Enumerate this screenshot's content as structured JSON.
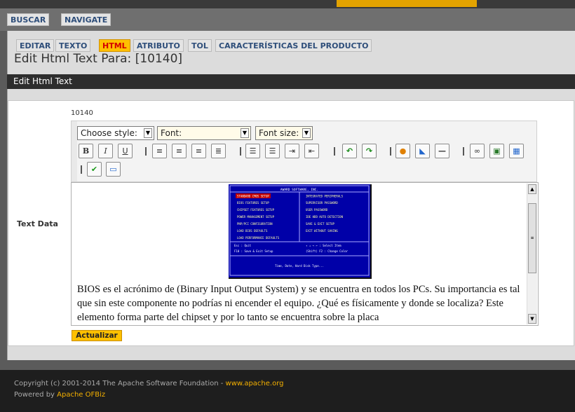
{
  "nav": {
    "buscar": "BUSCAR",
    "navigate": "NAVIGATE"
  },
  "tabs": [
    "EDITAR",
    "TEXTO",
    "HTML",
    "ATRIBUTO",
    "TOL",
    "CARACTERÍSTICAS DEL PRODUCTO"
  ],
  "title": "Edit Html Text Para: [10140]",
  "section_title": "Edit Html Text",
  "form": {
    "id": "10140",
    "text_data_label": "Text Data",
    "style_select": "Choose style:",
    "font_select": "Font:",
    "font_size_select": "Font size:",
    "submit_label": "Actualizar"
  },
  "editor_text": "BIOS es el acrónimo de (Binary Input Output System) y se encuentra en todos los PCs. Su importancia es tal que sin este componente no podrías ni encender el equipo. ¿Qué es físicamente y donde se localiza? Este elemento forma parte del chipset y por lo tanto se encuentra sobre la placa",
  "bios_screen": {
    "header": "AWARD SOFTWARE, INC.",
    "left": [
      "STANDARD CMOS SETUP",
      "BIOS FEATURES SETUP",
      "CHIPSET FEATURES SETUP",
      "POWER MANAGEMENT SETUP",
      "PNP/PCI CONFIGURATION",
      "LOAD BIOS DEFAULTS",
      "LOAD PERFORMANCE DEFAULTS"
    ],
    "right": [
      "INTEGRATED PERIPHERALS",
      "SUPERVISOR PASSWORD",
      "USER PASSWORD",
      "IDE HDD AUTO DETECTION",
      "SAVE & EXIT SETUP",
      "EXIT WITHOUT SAVING"
    ],
    "keys_left1": "Esc : Quit",
    "keys_right1": "↑ ↓ → ← : Select Item",
    "keys_left2": "F10 : Save & Exit Setup",
    "keys_right2": "(Shift) F2 : Change Color",
    "footer": "Time, Date, Hard Disk Type..."
  },
  "footer": {
    "copyright_text": "Copyright (c) 2001-2014 The Apache Software Foundation - ",
    "copyright_link": "www.apache.org",
    "powered_text": "Powered by ",
    "powered_link": "Apache OFBiz"
  },
  "colors": {
    "accent": "#ffc000",
    "bios_blue": "#0000a8"
  }
}
